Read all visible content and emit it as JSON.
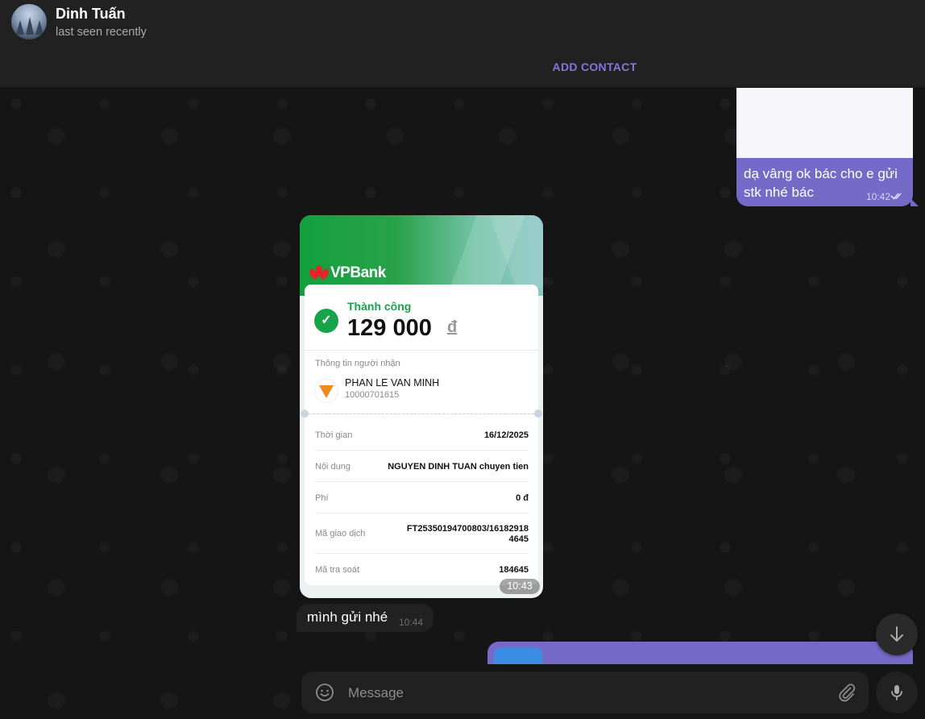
{
  "header": {
    "name": "Dinh Tuấn",
    "status": "last seen recently",
    "add_contact": "ADD CONTACT"
  },
  "messages": {
    "out_top": {
      "text": "dạ vâng ok bác cho e gửi stk nhé bác",
      "time": "10:42"
    },
    "receipt": {
      "bank": "VPBank",
      "status": "Thành công",
      "amount": "129 000",
      "currency": "đ",
      "recipient_title": "Thông tin người nhận",
      "recipient_name": "PHAN LE VAN MINH",
      "recipient_account": "10000701615",
      "rows": [
        {
          "label": "Thời gian",
          "value": "16/12/2025"
        },
        {
          "label": "Nội dung",
          "value": "NGUYEN DINH TUAN chuyen tien"
        },
        {
          "label": "Phí",
          "value": "0  đ"
        },
        {
          "label": "Mã giao dịch",
          "value": "FT25350194700803/16182918 4645"
        },
        {
          "label": "Mã tra soát",
          "value": "184645"
        }
      ],
      "time": "10:43"
    },
    "in_msg": {
      "text": "mình gửi nhé",
      "time": "10:44"
    }
  },
  "composer": {
    "placeholder": "Message"
  },
  "colors": {
    "accent": "#8774e1",
    "out_bubble": "#766ac8",
    "success": "#16a34a"
  }
}
